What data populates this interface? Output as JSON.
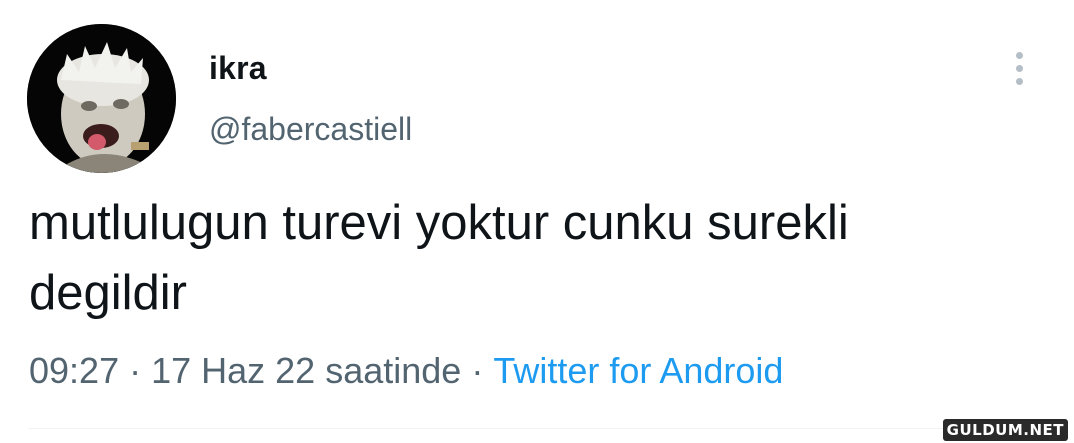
{
  "author": {
    "display_name": "ikra",
    "handle": "@fabercastiell",
    "avatar_icon": "profile-photo"
  },
  "tweet": {
    "text_line1": "mutlulugun turevi yoktur cunku surekli",
    "text_line2": "degildir"
  },
  "meta": {
    "time": "09:27",
    "separator": "·",
    "date": "17 Haz 22 saatinde",
    "source": "Twitter for Android"
  },
  "menu": {
    "icon": "more-vertical-icon"
  },
  "watermark": {
    "text": "GULDUM.NET"
  },
  "colors": {
    "text_primary": "#0f1419",
    "text_secondary": "#536471",
    "link": "#1d9bf0",
    "divider": "#eff3f4"
  }
}
